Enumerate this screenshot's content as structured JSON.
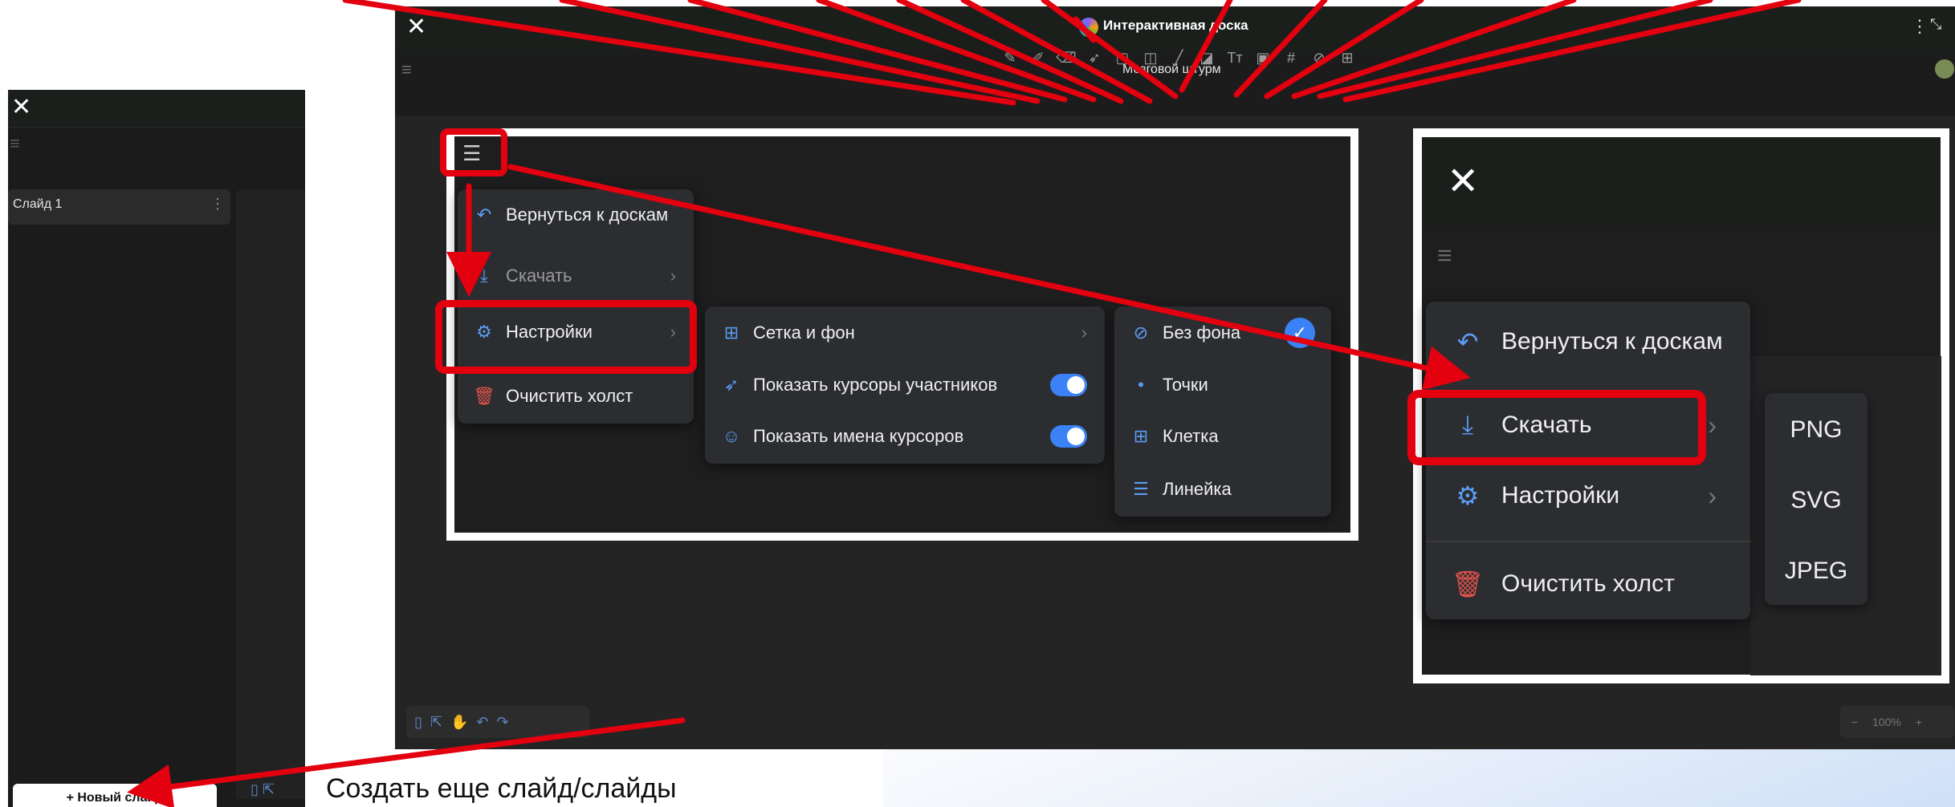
{
  "caption": {
    "create_slides": "Создать еще слайд/слайды"
  },
  "sidebar": {
    "slide_label": "Слайд 1",
    "new_slide_label": "+ Новый слайд"
  },
  "main": {
    "app_title": "Интерактивная доска",
    "board_name": "Мозговой штурм",
    "zoom": "100%",
    "toolbar_icons": [
      "pencil-icon",
      "marker-icon",
      "eraser-icon",
      "pointer-icon",
      "rectangle-icon",
      "shapes-icon",
      "line-icon",
      "sticky-note-icon",
      "text-icon",
      "image-icon",
      "grid-icon",
      "attach-icon",
      "table-icon"
    ]
  },
  "menu1": {
    "items": [
      {
        "label": "Вернуться к доскам",
        "icon": "undo-icon"
      },
      {
        "label": "Скачать",
        "icon": "download-icon"
      },
      {
        "label": "Настройки",
        "icon": "gear-icon"
      },
      {
        "label": "Очистить холст",
        "icon": "trash-icon"
      }
    ]
  },
  "menu2": {
    "items": [
      {
        "label": "Сетка и фон",
        "icon": "grid-icon"
      },
      {
        "label": "Показать курсоры участников",
        "icon": "cursor-icon",
        "on": true
      },
      {
        "label": "Показать имена курсоров",
        "icon": "user-icon",
        "on": true
      }
    ]
  },
  "menu3": {
    "items": [
      {
        "label": "Без фона",
        "icon": "no-background-icon",
        "selected": true
      },
      {
        "label": "Точки",
        "icon": "dots-icon"
      },
      {
        "label": "Клетка",
        "icon": "grid-icon"
      },
      {
        "label": "Линейка",
        "icon": "lines-icon"
      }
    ]
  },
  "menu4": {
    "items": [
      {
        "label": "Вернуться к доскам",
        "icon": "undo-icon"
      },
      {
        "label": "Скачать",
        "icon": "download-icon"
      },
      {
        "label": "Настройки",
        "icon": "gear-icon"
      },
      {
        "label": "Очистить холст",
        "icon": "trash-icon"
      }
    ]
  },
  "menu5": {
    "formats": [
      "PNG",
      "SVG",
      "JPEG"
    ]
  },
  "colors": {
    "accent": "#3b82f6",
    "highlight": "#e3000f",
    "trash": "#e5534b"
  }
}
